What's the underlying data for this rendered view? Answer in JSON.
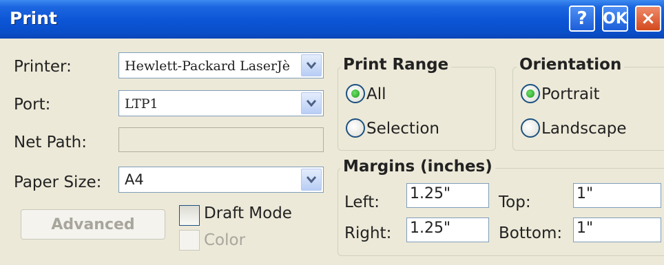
{
  "window": {
    "title": "Print",
    "help_button": "?",
    "ok_button": "OK",
    "close_button": "×"
  },
  "printer": {
    "label": "Printer:",
    "value": "Hewlett-Packard LaserJè"
  },
  "port": {
    "label": "Port:",
    "value": "LTP1"
  },
  "net_path": {
    "label": "Net Path:",
    "value": ""
  },
  "paper_size": {
    "label": "Paper Size:",
    "value": "A4"
  },
  "advanced_button": "Advanced",
  "draft_mode": {
    "label": "Draft Mode",
    "checked": false
  },
  "color": {
    "label": "Color",
    "checked": false,
    "enabled": false
  },
  "print_range": {
    "title": "Print Range",
    "options": [
      {
        "label": "All",
        "selected": true
      },
      {
        "label": "Selection",
        "selected": false
      }
    ]
  },
  "orientation": {
    "title": "Orientation",
    "options": [
      {
        "label": "Portrait",
        "selected": true
      },
      {
        "label": "Landscape",
        "selected": false
      }
    ]
  },
  "margins": {
    "title": "Margins (inches)",
    "left_label": "Left:",
    "left_value": "1.25\"",
    "right_label": "Right:",
    "right_value": "1.25\"",
    "top_label": "Top:",
    "top_value": "1\"",
    "bottom_label": "Bottom:",
    "bottom_value": "1\""
  },
  "colors": {
    "titlebar": "#0b55d6",
    "dialog_bg": "#ece9d8",
    "radio_selected": "#1f9a1b",
    "close_button": "#d3491d"
  },
  "icons": [
    "help-icon",
    "ok-icon",
    "close-icon",
    "dropdown-arrow-icon"
  ]
}
